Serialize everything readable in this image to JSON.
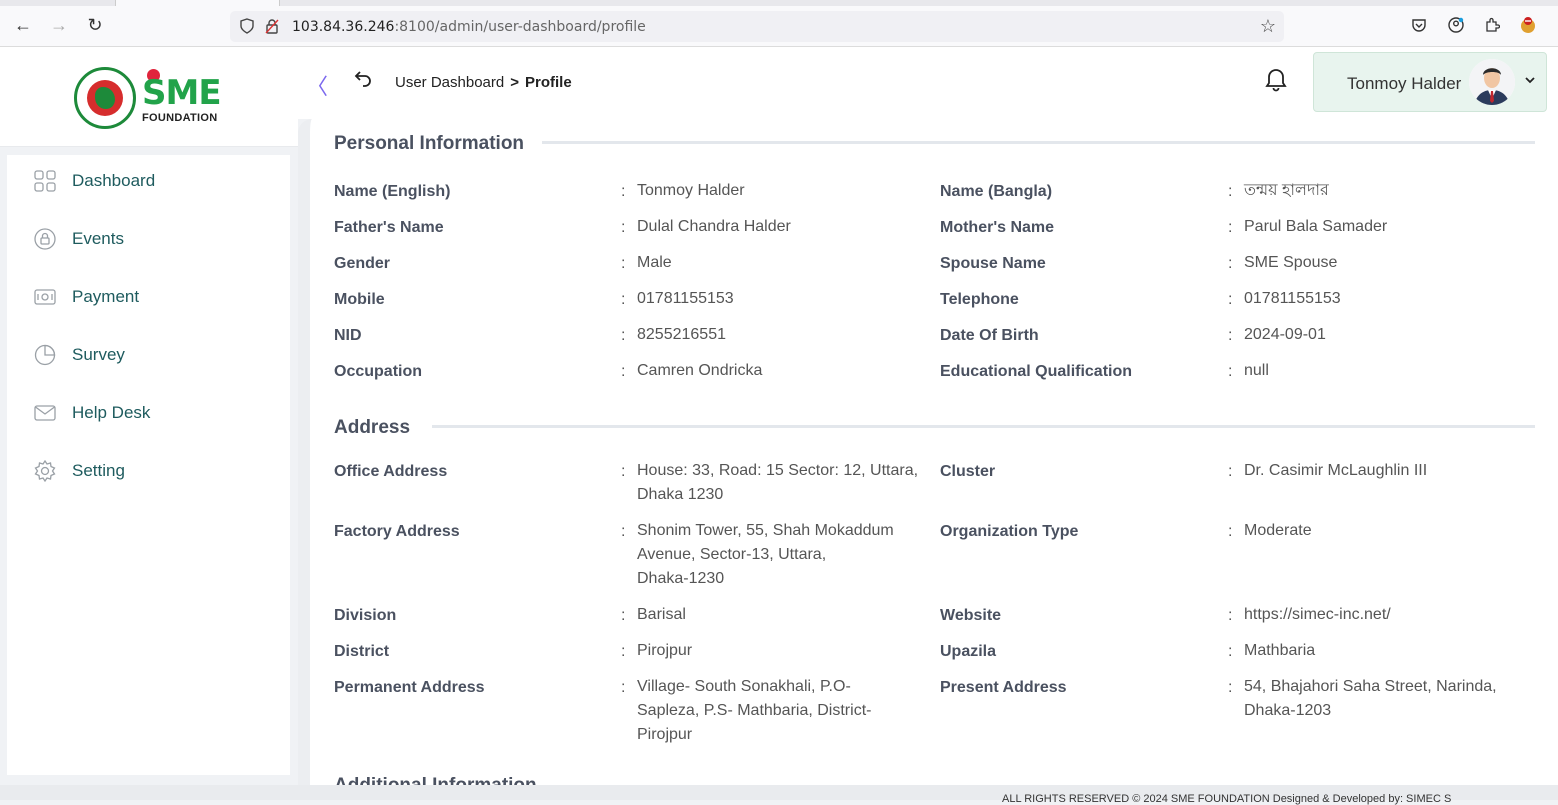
{
  "browser": {
    "url_host": "103.84.36.246",
    "url_path": ":8100/admin/user-dashboard/profile"
  },
  "logo": {
    "brand": "SME",
    "subtitle": "FOUNDATION"
  },
  "sidebar": {
    "items": [
      {
        "label": "Dashboard",
        "icon": "grid-icon"
      },
      {
        "label": "Events",
        "icon": "lock-icon"
      },
      {
        "label": "Payment",
        "icon": "cash-icon"
      },
      {
        "label": "Survey",
        "icon": "pie-chart-icon"
      },
      {
        "label": "Help Desk",
        "icon": "mail-icon"
      },
      {
        "label": "Setting",
        "icon": "gear-icon"
      }
    ]
  },
  "header": {
    "breadcrumb_parent": "User Dashboard",
    "breadcrumb_current": "Profile",
    "user_name": "Tonmoy Halder"
  },
  "personal": {
    "title": "Personal Information",
    "rows": [
      {
        "l1": "Name (English)",
        "v1": "Tonmoy Halder",
        "l2": "Name (Bangla)",
        "v2": "তন্ময় হালদার"
      },
      {
        "l1": "Father's Name",
        "v1": "Dulal Chandra Halder",
        "l2": "Mother's Name",
        "v2": "Parul Bala Samader"
      },
      {
        "l1": "Gender",
        "v1": "Male",
        "l2": "Spouse Name",
        "v2": "SME Spouse"
      },
      {
        "l1": "Mobile",
        "v1": "01781155153",
        "l2": "Telephone",
        "v2": "01781155153"
      },
      {
        "l1": "NID",
        "v1": "8255216551",
        "l2": "Date Of Birth",
        "v2": "2024-09-01"
      },
      {
        "l1": "Occupation",
        "v1": "Camren Ondricka",
        "l2": "Educational Qualification",
        "v2": "null"
      }
    ]
  },
  "address": {
    "title": "Address",
    "rows": [
      {
        "l1": "Office Address",
        "v1a": "House: 33, Road: 15 Sector: 12, Uttara,",
        "v1b": "Dhaka 1230",
        "l2": "Cluster",
        "v2a": "Dr. Casimir McLaughlin III"
      },
      {
        "l1": "Factory Address",
        "v1a": "Shonim Tower, 55, Shah Mokaddum",
        "v1b": "Avenue, Sector-13, Uttara,",
        "v1c": "Dhaka-1230",
        "l2": "Organization Type",
        "v2a": "Moderate"
      },
      {
        "l1": "Division",
        "v1a": "Barisal",
        "l2": "Website",
        "v2a": "https://simec-inc.net/"
      },
      {
        "l1": "District",
        "v1a": "Pirojpur",
        "l2": "Upazila",
        "v2a": "Mathbaria"
      },
      {
        "l1": "Permanent Address",
        "v1a": "Village- South Sonakhali, P.O-",
        "v1b": "Sapleza, P.S- Mathbaria, District-",
        "v1c": "Pirojpur",
        "l2": "Present Address",
        "v2a": "54, Bhajahori Saha Street, Narinda,",
        "v2b": "Dhaka-1203"
      }
    ]
  },
  "additional": {
    "title": "Additional Information"
  },
  "colon": ":",
  "footer": {
    "text": "ALL RIGHTS RESERVED © 2024 SME FOUNDATION   Designed & Developed by: SIMEC S"
  }
}
